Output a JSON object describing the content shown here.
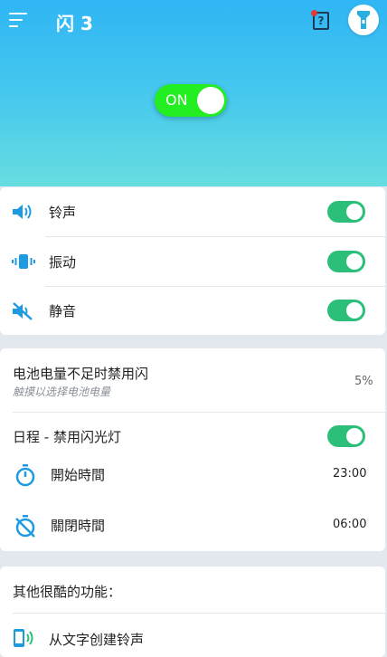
{
  "header": {
    "title": "闪 3",
    "power_toggle": {
      "label": "ON",
      "on": true
    },
    "help_icon_glyph": "?",
    "accent_colors": {
      "top": "#2fb6f4",
      "bottom": "#66dde0",
      "toggle": "#22ee22",
      "switch_on": "#2bbf7a"
    }
  },
  "modes": {
    "items": [
      {
        "label": "铃声",
        "icon": "speaker-icon",
        "on": true
      },
      {
        "label": "振动",
        "icon": "vibrate-icon",
        "on": true
      },
      {
        "label": "静音",
        "icon": "mute-icon",
        "on": true
      }
    ]
  },
  "battery": {
    "title": "电池电量不足时禁用闪",
    "subtitle": "触摸以选择电池电量",
    "value": "5%"
  },
  "schedule": {
    "title": "日程 - 禁用闪光灯",
    "on": true,
    "start_label": "開始時間",
    "start_value": "23:00",
    "end_label": "關閉時間",
    "end_value": "06:00"
  },
  "extras": {
    "title": "其他很酷的功能：",
    "items": [
      {
        "label": "从文字创建铃声",
        "icon": "phone-sound-icon"
      }
    ]
  }
}
